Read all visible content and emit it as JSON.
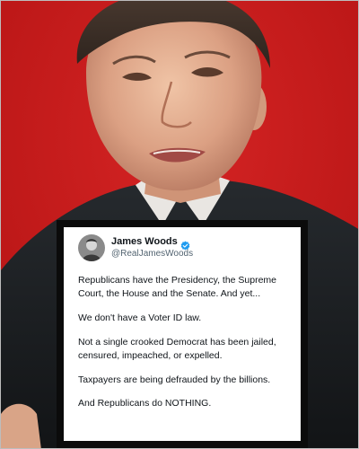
{
  "tweet": {
    "display_name": "James Woods",
    "handle": "@RealJamesWoods",
    "paragraphs": [
      "Republicans have the Presidency, the Supreme Court, the House and the Senate. And yet...",
      "We don't have a Voter ID law.",
      "Not a single crooked Democrat has been jailed, censured, impeached, or expelled.",
      "Taxpayers are being defrauded by the billions.",
      "And Republicans do NOTHING."
    ]
  },
  "icons": {
    "verified": "verified-badge-icon"
  },
  "colors": {
    "background_red": "#cf1f1f",
    "verified_blue": "#1d9bf0",
    "handle_gray": "#536471",
    "text_dark": "#0f1419"
  }
}
